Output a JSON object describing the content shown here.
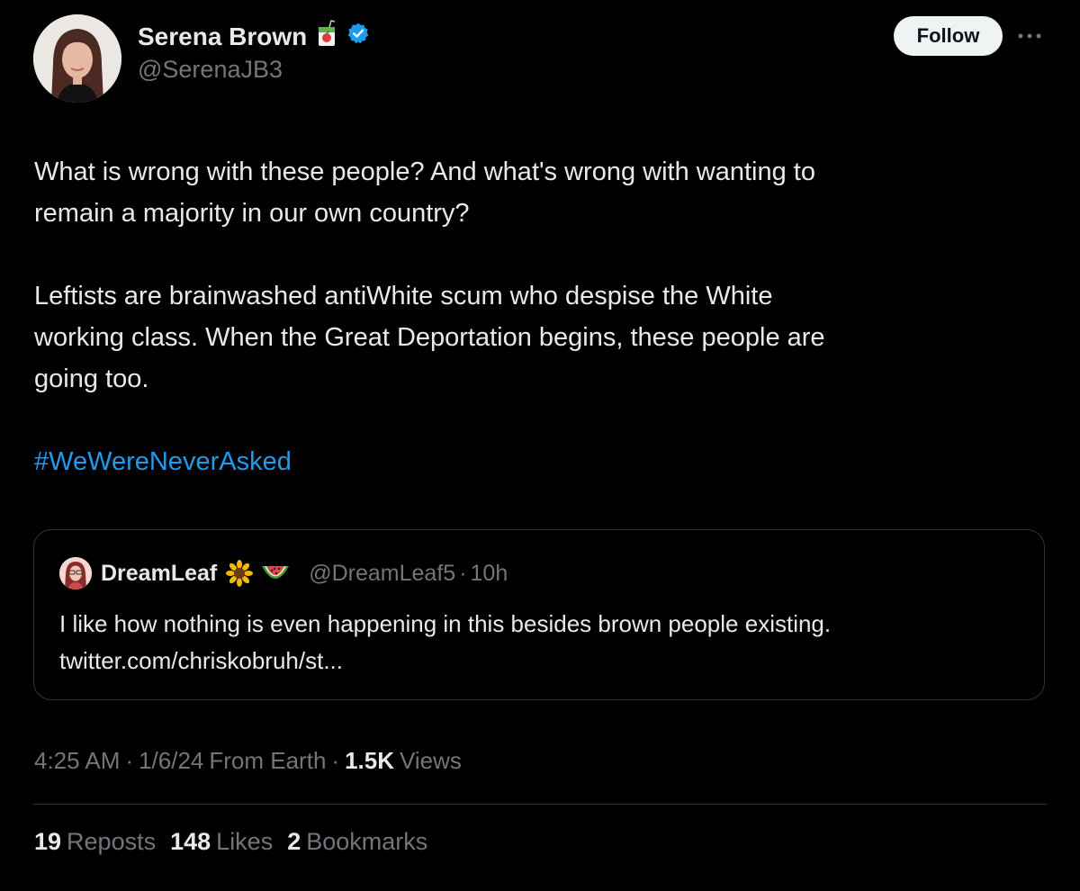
{
  "author": {
    "display_name": "Serena Brown",
    "handle": "@SerenaJB3",
    "verified_color": "#1d9bf0"
  },
  "follow_label": "Follow",
  "tweet": {
    "p1_line1": "What is wrong with these people? And what's wrong with wanting to",
    "p1_line2": "remain a majority in our own country?",
    "p2_line1": "Leftists are brainwashed antiWhite scum who despise the White",
    "p2_line2": "working class. When the Great Deportation begins, these people are",
    "p2_line3": "going too.",
    "hashtag": "#WeWereNeverAsked"
  },
  "quote": {
    "name": "DreamLeaf",
    "handle": "@DreamLeaf5",
    "separator": "·",
    "time": "10h",
    "line1": "I like how nothing is even happening in this besides brown people existing.",
    "line2": "twitter.com/chriskobruh/st..."
  },
  "meta": {
    "time": "4:25 AM",
    "sep1": "·",
    "date": "1/6/24",
    "source": "From Earth",
    "sep2": "·",
    "views_count": "1.5K",
    "views_label": "Views"
  },
  "stats": {
    "reposts_count": "19",
    "reposts_label": "Reposts",
    "likes_count": "148",
    "likes_label": "Likes",
    "bookmarks_count": "2",
    "bookmarks_label": "Bookmarks"
  }
}
